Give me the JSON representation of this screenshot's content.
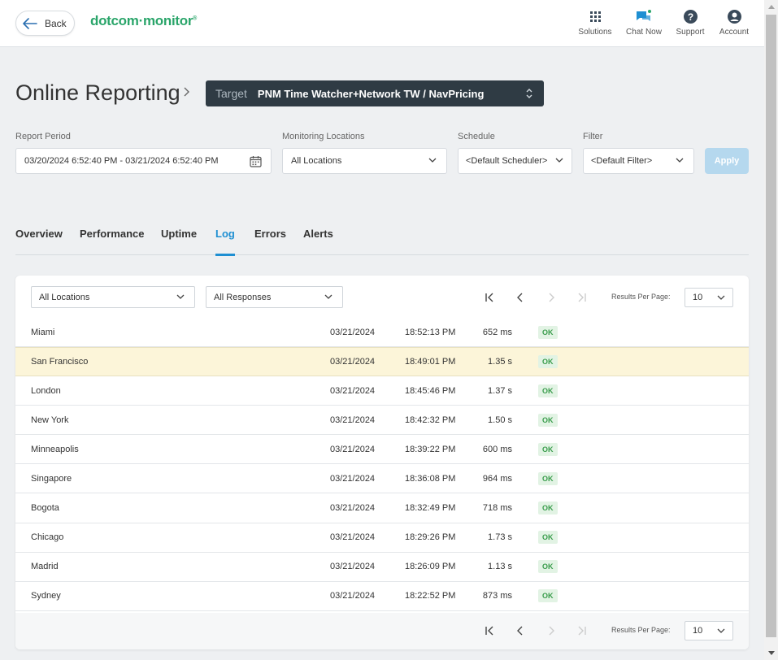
{
  "header": {
    "back_label": "Back",
    "logo": {
      "part1": "dotcom",
      "part2": "·",
      "part3": "monitor",
      "reg": "®"
    },
    "items": [
      {
        "label": "Solutions",
        "icon": "grid-icon"
      },
      {
        "label": "Chat Now",
        "icon": "chat-icon"
      },
      {
        "label": "Support",
        "icon": "help-icon"
      },
      {
        "label": "Account",
        "icon": "account-icon"
      }
    ],
    "brand_color": "#2aa56a"
  },
  "page": {
    "title": "Online Reporting",
    "target_label": "Target",
    "target_value": "PNM Time Watcher+Network TW / NavPricing"
  },
  "filters": {
    "report_period": {
      "label": "Report Period",
      "value": "03/20/2024 6:52:40 PM - 03/21/2024 6:52:40 PM"
    },
    "monitoring_locations": {
      "label": "Monitoring Locations",
      "value": "All Locations"
    },
    "schedule": {
      "label": "Schedule",
      "value": "<Default Scheduler>"
    },
    "filter": {
      "label": "Filter",
      "value": "<Default Filter>"
    },
    "apply_label": "Apply"
  },
  "tabs": [
    {
      "label": "Overview"
    },
    {
      "label": "Performance"
    },
    {
      "label": "Uptime"
    },
    {
      "label": "Log",
      "active": true
    },
    {
      "label": "Errors"
    },
    {
      "label": "Alerts"
    }
  ],
  "log": {
    "location_filter": "All Locations",
    "response_filter": "All Responses",
    "results_per_page_label": "Results Per Page:",
    "results_per_page": "10",
    "rows": [
      {
        "location": "Miami",
        "date": "03/21/2024",
        "time": "18:52:13 PM",
        "duration": "652 ms",
        "status": "OK"
      },
      {
        "location": "San Francisco",
        "date": "03/21/2024",
        "time": "18:49:01 PM",
        "duration": "1.35 s",
        "status": "OK"
      },
      {
        "location": "London",
        "date": "03/21/2024",
        "time": "18:45:46 PM",
        "duration": "1.37 s",
        "status": "OK"
      },
      {
        "location": "New York",
        "date": "03/21/2024",
        "time": "18:42:32 PM",
        "duration": "1.50 s",
        "status": "OK"
      },
      {
        "location": "Minneapolis",
        "date": "03/21/2024",
        "time": "18:39:22 PM",
        "duration": "600 ms",
        "status": "OK"
      },
      {
        "location": "Singapore",
        "date": "03/21/2024",
        "time": "18:36:08 PM",
        "duration": "964 ms",
        "status": "OK"
      },
      {
        "location": "Bogota",
        "date": "03/21/2024",
        "time": "18:32:49 PM",
        "duration": "718 ms",
        "status": "OK"
      },
      {
        "location": "Chicago",
        "date": "03/21/2024",
        "time": "18:29:26 PM",
        "duration": "1.73 s",
        "status": "OK"
      },
      {
        "location": "Madrid",
        "date": "03/21/2024",
        "time": "18:26:09 PM",
        "duration": "1.13 s",
        "status": "OK"
      },
      {
        "location": "Sydney",
        "date": "03/21/2024",
        "time": "18:22:52 PM",
        "duration": "873 ms",
        "status": "OK"
      }
    ],
    "highlighted_row": 1
  }
}
